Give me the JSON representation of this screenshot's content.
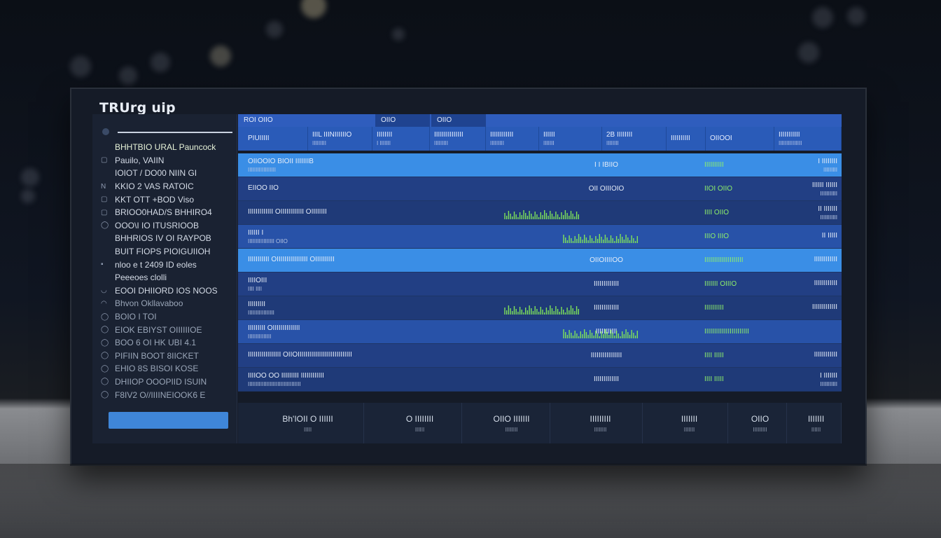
{
  "app": {
    "title": "TRUrg uip"
  },
  "colors": {
    "accent": "#3f86d8",
    "header": "#2a5bb8",
    "highlight_row": "#3a8ee6",
    "positive": "#8ef06a",
    "sidebar_bg": "#1a2232"
  },
  "sidebar": {
    "items": [
      {
        "icon": "",
        "label": "BHHTBIO URAL Pauncock",
        "state": "active"
      },
      {
        "icon": "▢",
        "label": "Pauilo, VAIIN",
        "state": ""
      },
      {
        "icon": "",
        "label": "IOIOT / DO00 NIIN GI",
        "state": ""
      },
      {
        "icon": "N",
        "label": "KKIO 2 VAS RATOIC",
        "state": ""
      },
      {
        "icon": "▢",
        "label": "KKT OTT +BOD Viso",
        "state": ""
      },
      {
        "icon": "▢",
        "label": "BRIOO0HAD/S BHHIRO4",
        "state": ""
      },
      {
        "icon": "◯",
        "label": "OOO\\I IO ITUSRIOOB",
        "state": ""
      },
      {
        "icon": "",
        "label": "BHHRIOS IV OI RAYPOB",
        "state": ""
      },
      {
        "icon": "",
        "label": "BUIT FIOPS PIOIGUIIOH",
        "state": ""
      },
      {
        "icon": "▪",
        "label": "nloo e t 2409 ID eoles",
        "state": ""
      },
      {
        "icon": "",
        "label": "Peeeoes clolli",
        "state": ""
      },
      {
        "icon": "◡",
        "label": "EOOI DHIIORD IOS NOOS",
        "state": ""
      },
      {
        "icon": "◠",
        "label": "Bhvon Okllavaboo",
        "state": "dim"
      },
      {
        "icon": "◯",
        "label": "BOIO I TOI",
        "state": "dim"
      },
      {
        "icon": "◯",
        "label": "EIOK EBIYST OIIIIIIOE",
        "state": "dim"
      },
      {
        "icon": "◯",
        "label": "BOO 6 OI HK UBI 4.1",
        "state": "dim"
      },
      {
        "icon": "◯",
        "label": "PIFIIN BOOT 8IICKET",
        "state": "dim"
      },
      {
        "icon": "◯",
        "label": "EHIO 8S BISOI KOSE",
        "state": "dim"
      },
      {
        "icon": "◯",
        "label": "DHIIOP OOOPIID ISUIN",
        "state": "dim"
      },
      {
        "icon": "◯",
        "label": "F8IV2 O//IIIINEIOOK6 E",
        "state": "dim"
      }
    ]
  },
  "tabs": [
    {
      "label": "ROI OIIO",
      "active": false
    },
    {
      "label": "OIIO",
      "active": true
    },
    {
      "label": "OIIO",
      "active": true
    }
  ],
  "headers": [
    {
      "label": "PIUIIIII",
      "sub": ""
    },
    {
      "label": "IIIL IIINIIIIIIO",
      "sub": "IIIIIIIII"
    },
    {
      "label": "IIIIIIII",
      "sub": "I IIIIIII"
    },
    {
      "label": "IIIIIIIIIIIIIII",
      "sub": "IIIIIIIII"
    },
    {
      "label": "IIIIIIIIIIII",
      "sub": "IIIIIIIII"
    },
    {
      "label": "IIIIII",
      "sub": "IIIIIII"
    },
    {
      "label": "2B IIIIIIII",
      "sub": "IIIIIIII"
    },
    {
      "label": "IIIIIIIIII",
      "sub": ""
    },
    {
      "label": "OIIOOI",
      "sub": ""
    },
    {
      "label": "IIIIIIIIIII",
      "sub": "IIIIIIIIIIIIIII"
    }
  ],
  "rows": [
    {
      "name": "OIIOOIO BIOII IIIIIIIB",
      "sub": "IIIIIIIIIIIIIIIIII",
      "mid": "I I IBIIO",
      "val": "IIIIIIIIII",
      "right": "I IIIIIIII",
      "right_sub": "IIIIIIIII",
      "style": "hl",
      "spark": false
    },
    {
      "name": "EIIOO IIO",
      "sub": "",
      "mid": "OII OIIIOIO",
      "val": "IIOI OIIO",
      "right": "IIIIII IIIIII",
      "right_sub": "IIIIIIIIIII",
      "style": "",
      "spark": false
    },
    {
      "name": "IIIIIIIIIIIII  OIIIIIIIIIIII OIIIIIIII",
      "sub": "",
      "mid": "",
      "val": "IIII OIIO",
      "right": "II IIIIIII",
      "right_sub": "IIIIIIIIIII",
      "style": "alt",
      "spark": true
    },
    {
      "name": "IIIIII I",
      "sub": "IIIIIIIIIIIIIIIII OIIO",
      "mid": "",
      "val": "IIIO IIIO",
      "right": "II IIIII",
      "right_sub": "",
      "style": "mid",
      "spark": true
    },
    {
      "name": "IIIIIIIIIII  OIIIIIIIIIIIIIIII OIIIIIIIIII",
      "sub": "",
      "mid": "OIIOIIIIOO",
      "val": "IIIIIIIIIIIIIIIIIIII",
      "right": "IIIIIIIIIIII",
      "right_sub": "",
      "style": "hl",
      "spark": false
    },
    {
      "name": "IIIIOIII",
      "sub": "IIII IIII",
      "mid": "IIIIIIIIIIIII",
      "val": "IIIIIII OIIIO",
      "right": "IIIIIIIIIIII",
      "right_sub": "",
      "style": "",
      "spark": false
    },
    {
      "name": "IIIIIIIII",
      "sub": "IIIIIIIIIIIIIIIII",
      "mid": "IIIIIIIIIIIII",
      "val": "IIIIIIIIII",
      "right": "IIIIIIIIIIIII",
      "right_sub": "",
      "style": "alt",
      "spark": true
    },
    {
      "name": "IIIIIIIII  OIIIIIIIIIIIIII",
      "sub": "IIIIIIIIIIIIIII",
      "mid": "IIIIIIIIIII",
      "val": "IIIIIIIIIIIIIIIIIIIIIII",
      "right": "",
      "right_sub": "",
      "style": "mid",
      "spark": true
    },
    {
      "name": "IIIIIIIIIIIIIIIII  OIIOIIIIIIIIIIIIIIIIIIIIIIIIIIII",
      "sub": "",
      "mid": "IIIIIIIIIIIIIIII",
      "val": "IIII IIIII",
      "right": "IIIIIIIIIIII",
      "right_sub": "",
      "style": "",
      "spark": false
    },
    {
      "name": "IIIIOO OO IIIIIIIII IIIIIIIIIIII",
      "sub": "IIIIIIIIIIIIIIIIIIIIIIIIIIIIIIIIII",
      "mid": "IIIIIIIIIIIII",
      "val": "IIII IIIII",
      "right": "I IIIIIII",
      "right_sub": "IIIIIIIIIII",
      "style": "alt",
      "spark": false
    }
  ],
  "footer": [
    {
      "value": "Bh'IOII O IIIIII",
      "label": "IIIII"
    },
    {
      "value": "O IIIIIIII",
      "label": "IIIIII"
    },
    {
      "value": "OIIO IIIIIII",
      "label": "IIIIIIII"
    },
    {
      "value": "IIIIIIIII",
      "label": "IIIIIIII"
    },
    {
      "value": "IIIIIII",
      "label": "IIIIIII"
    },
    {
      "value": "OIIO",
      "label": "IIIIIIIII"
    },
    {
      "value": "IIIIIII",
      "label": "IIIIII"
    }
  ]
}
